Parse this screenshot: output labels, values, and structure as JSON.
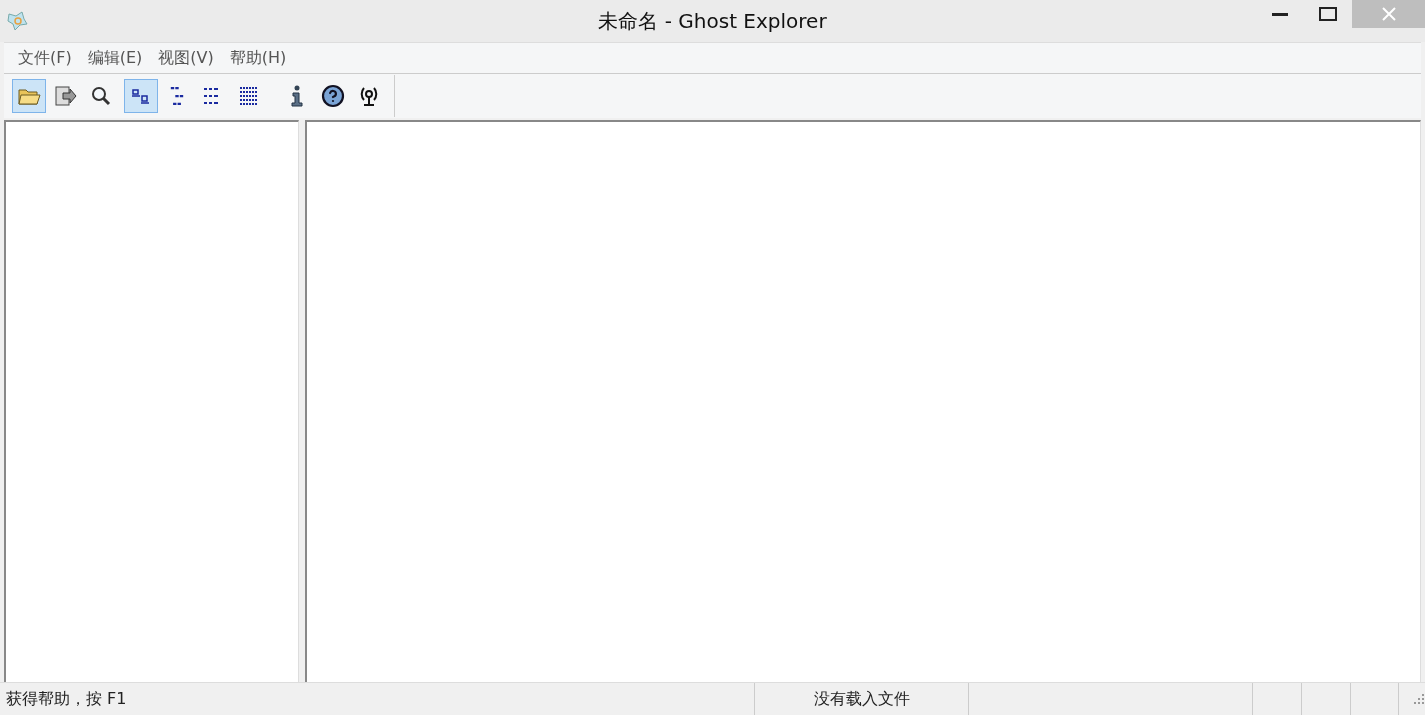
{
  "window": {
    "title": "未命名 - Ghost Explorer"
  },
  "menu": [
    "文件(F)",
    "编辑(E)",
    "视图(V)",
    "帮助(H)"
  ],
  "toolbar": [
    [
      {
        "selected": true
      },
      {
        "selected": false
      }
    ],
    [
      {
        "selected": false
      }
    ],
    [
      {
        "selected": true
      },
      {
        "selected": false
      },
      {
        "selected": false
      },
      {
        "selected": false
      }
    ],
    [
      {
        "selected": false
      },
      {
        "selected": false
      },
      {
        "selected": false
      }
    ]
  ],
  "status_bar": {
    "message": "获得帮助，按 F1",
    "file_status": "没有载入文件"
  }
}
